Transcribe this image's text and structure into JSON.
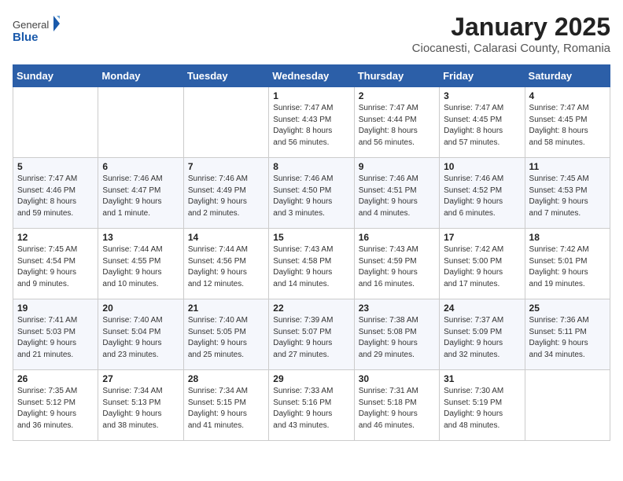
{
  "header": {
    "logo_general": "General",
    "logo_blue": "Blue",
    "title": "January 2025",
    "subtitle": "Ciocanesti, Calarasi County, Romania"
  },
  "calendar": {
    "days_of_week": [
      "Sunday",
      "Monday",
      "Tuesday",
      "Wednesday",
      "Thursday",
      "Friday",
      "Saturday"
    ],
    "weeks": [
      [
        {
          "day": "",
          "info": ""
        },
        {
          "day": "",
          "info": ""
        },
        {
          "day": "",
          "info": ""
        },
        {
          "day": "1",
          "info": "Sunrise: 7:47 AM\nSunset: 4:43 PM\nDaylight: 8 hours\nand 56 minutes."
        },
        {
          "day": "2",
          "info": "Sunrise: 7:47 AM\nSunset: 4:44 PM\nDaylight: 8 hours\nand 56 minutes."
        },
        {
          "day": "3",
          "info": "Sunrise: 7:47 AM\nSunset: 4:45 PM\nDaylight: 8 hours\nand 57 minutes."
        },
        {
          "day": "4",
          "info": "Sunrise: 7:47 AM\nSunset: 4:45 PM\nDaylight: 8 hours\nand 58 minutes."
        }
      ],
      [
        {
          "day": "5",
          "info": "Sunrise: 7:47 AM\nSunset: 4:46 PM\nDaylight: 8 hours\nand 59 minutes."
        },
        {
          "day": "6",
          "info": "Sunrise: 7:46 AM\nSunset: 4:47 PM\nDaylight: 9 hours\nand 1 minute."
        },
        {
          "day": "7",
          "info": "Sunrise: 7:46 AM\nSunset: 4:49 PM\nDaylight: 9 hours\nand 2 minutes."
        },
        {
          "day": "8",
          "info": "Sunrise: 7:46 AM\nSunset: 4:50 PM\nDaylight: 9 hours\nand 3 minutes."
        },
        {
          "day": "9",
          "info": "Sunrise: 7:46 AM\nSunset: 4:51 PM\nDaylight: 9 hours\nand 4 minutes."
        },
        {
          "day": "10",
          "info": "Sunrise: 7:46 AM\nSunset: 4:52 PM\nDaylight: 9 hours\nand 6 minutes."
        },
        {
          "day": "11",
          "info": "Sunrise: 7:45 AM\nSunset: 4:53 PM\nDaylight: 9 hours\nand 7 minutes."
        }
      ],
      [
        {
          "day": "12",
          "info": "Sunrise: 7:45 AM\nSunset: 4:54 PM\nDaylight: 9 hours\nand 9 minutes."
        },
        {
          "day": "13",
          "info": "Sunrise: 7:44 AM\nSunset: 4:55 PM\nDaylight: 9 hours\nand 10 minutes."
        },
        {
          "day": "14",
          "info": "Sunrise: 7:44 AM\nSunset: 4:56 PM\nDaylight: 9 hours\nand 12 minutes."
        },
        {
          "day": "15",
          "info": "Sunrise: 7:43 AM\nSunset: 4:58 PM\nDaylight: 9 hours\nand 14 minutes."
        },
        {
          "day": "16",
          "info": "Sunrise: 7:43 AM\nSunset: 4:59 PM\nDaylight: 9 hours\nand 16 minutes."
        },
        {
          "day": "17",
          "info": "Sunrise: 7:42 AM\nSunset: 5:00 PM\nDaylight: 9 hours\nand 17 minutes."
        },
        {
          "day": "18",
          "info": "Sunrise: 7:42 AM\nSunset: 5:01 PM\nDaylight: 9 hours\nand 19 minutes."
        }
      ],
      [
        {
          "day": "19",
          "info": "Sunrise: 7:41 AM\nSunset: 5:03 PM\nDaylight: 9 hours\nand 21 minutes."
        },
        {
          "day": "20",
          "info": "Sunrise: 7:40 AM\nSunset: 5:04 PM\nDaylight: 9 hours\nand 23 minutes."
        },
        {
          "day": "21",
          "info": "Sunrise: 7:40 AM\nSunset: 5:05 PM\nDaylight: 9 hours\nand 25 minutes."
        },
        {
          "day": "22",
          "info": "Sunrise: 7:39 AM\nSunset: 5:07 PM\nDaylight: 9 hours\nand 27 minutes."
        },
        {
          "day": "23",
          "info": "Sunrise: 7:38 AM\nSunset: 5:08 PM\nDaylight: 9 hours\nand 29 minutes."
        },
        {
          "day": "24",
          "info": "Sunrise: 7:37 AM\nSunset: 5:09 PM\nDaylight: 9 hours\nand 32 minutes."
        },
        {
          "day": "25",
          "info": "Sunrise: 7:36 AM\nSunset: 5:11 PM\nDaylight: 9 hours\nand 34 minutes."
        }
      ],
      [
        {
          "day": "26",
          "info": "Sunrise: 7:35 AM\nSunset: 5:12 PM\nDaylight: 9 hours\nand 36 minutes."
        },
        {
          "day": "27",
          "info": "Sunrise: 7:34 AM\nSunset: 5:13 PM\nDaylight: 9 hours\nand 38 minutes."
        },
        {
          "day": "28",
          "info": "Sunrise: 7:34 AM\nSunset: 5:15 PM\nDaylight: 9 hours\nand 41 minutes."
        },
        {
          "day": "29",
          "info": "Sunrise: 7:33 AM\nSunset: 5:16 PM\nDaylight: 9 hours\nand 43 minutes."
        },
        {
          "day": "30",
          "info": "Sunrise: 7:31 AM\nSunset: 5:18 PM\nDaylight: 9 hours\nand 46 minutes."
        },
        {
          "day": "31",
          "info": "Sunrise: 7:30 AM\nSunset: 5:19 PM\nDaylight: 9 hours\nand 48 minutes."
        },
        {
          "day": "",
          "info": ""
        }
      ]
    ]
  }
}
